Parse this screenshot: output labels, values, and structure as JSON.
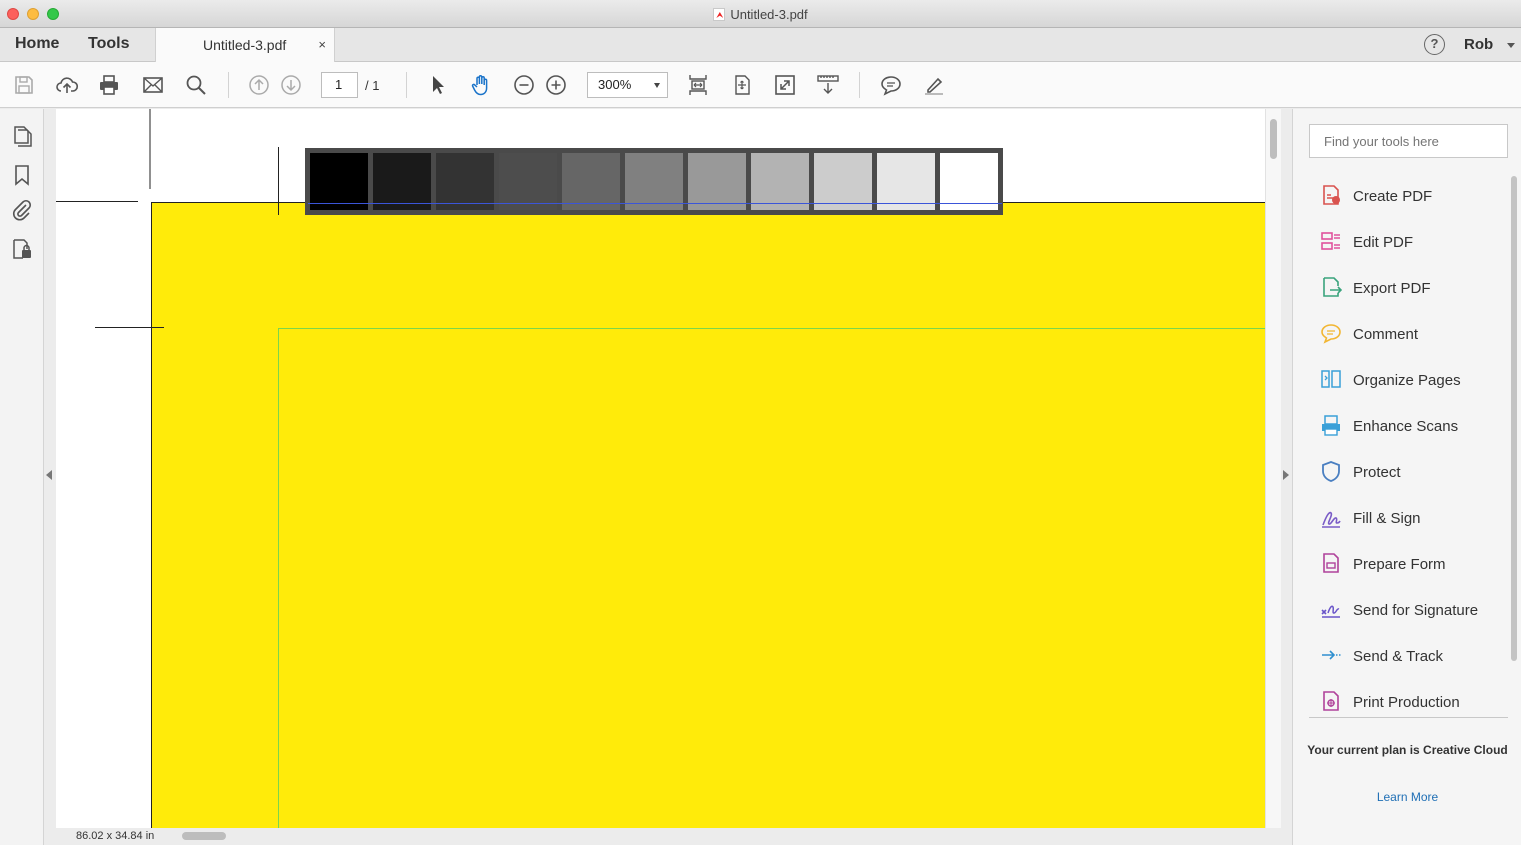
{
  "window": {
    "title": "Untitled-3.pdf"
  },
  "nav": {
    "home": "Home",
    "tools": "Tools"
  },
  "tab": {
    "label": "Untitled-3.pdf",
    "close": "×"
  },
  "user": {
    "name": "Rob",
    "help": "?"
  },
  "toolbar": {
    "page_current": "1",
    "page_total": "/ 1",
    "zoom": "300%"
  },
  "document": {
    "size_label": "86.02 x 34.84 in",
    "page_color": "#ffeb0a",
    "grayscale_swatches": [
      "#000000",
      "#1a1a1a",
      "#333333",
      "#4d4d4d",
      "#666666",
      "#808080",
      "#999999",
      "#b3b3b3",
      "#cccccc",
      "#e6e6e6",
      "#ffffff"
    ]
  },
  "tools_pane": {
    "search_placeholder": "Find your tools here",
    "items": [
      {
        "label": "Create PDF",
        "icon": "create-pdf-icon",
        "color": "#d9534f"
      },
      {
        "label": "Edit PDF",
        "icon": "edit-pdf-icon",
        "color": "#e0529c"
      },
      {
        "label": "Export PDF",
        "icon": "export-pdf-icon",
        "color": "#3aa37d"
      },
      {
        "label": "Comment",
        "icon": "comment-icon",
        "color": "#f2b632"
      },
      {
        "label": "Organize Pages",
        "icon": "organize-pages-icon",
        "color": "#3aa0d8"
      },
      {
        "label": "Enhance Scans",
        "icon": "enhance-scans-icon",
        "color": "#3aa0d8"
      },
      {
        "label": "Protect",
        "icon": "protect-icon",
        "color": "#4a7fc1"
      },
      {
        "label": "Fill & Sign",
        "icon": "fill-sign-icon",
        "color": "#7a5cc7"
      },
      {
        "label": "Prepare Form",
        "icon": "prepare-form-icon",
        "color": "#b0439b"
      },
      {
        "label": "Send for Signature",
        "icon": "send-signature-icon",
        "color": "#6a55c9"
      },
      {
        "label": "Send & Track",
        "icon": "send-track-icon",
        "color": "#2f8fd0"
      },
      {
        "label": "Print Production",
        "icon": "print-production-icon",
        "color": "#b0439b"
      }
    ],
    "plan_text": "Your current plan is Creative Cloud",
    "learn_more": "Learn More"
  }
}
